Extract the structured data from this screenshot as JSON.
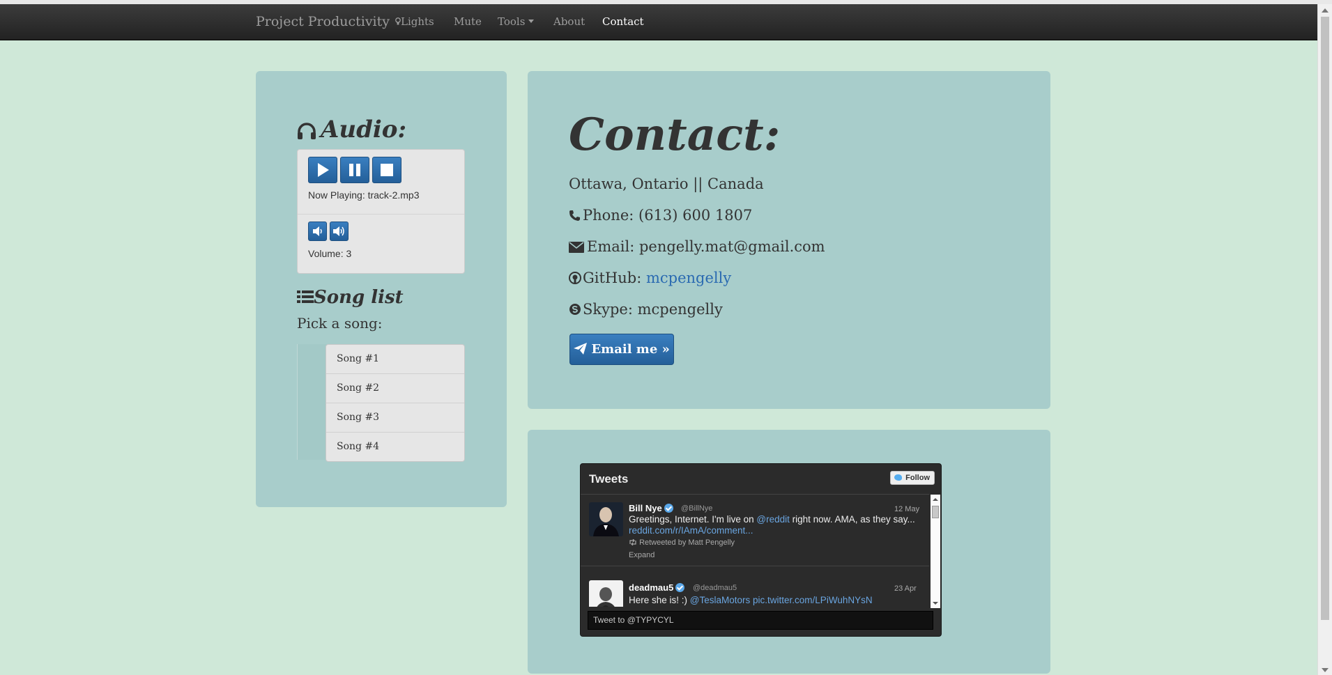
{
  "navbar": {
    "brand": "Project Productivity",
    "items": [
      {
        "label": "Lights",
        "icon": "lightbulb-icon"
      },
      {
        "label": "Mute"
      },
      {
        "label": "Tools",
        "icon": "caret-down-icon"
      },
      {
        "label": "About"
      },
      {
        "label": "Contact",
        "active": true
      }
    ]
  },
  "audio": {
    "title": "Audio:",
    "icon": "headphones-icon",
    "controls": [
      "play-icon",
      "pause-icon",
      "stop-icon"
    ],
    "now_playing": "Now Playing: track-2.mp3",
    "volume_controls": [
      "volume-down-icon",
      "volume-up-icon"
    ],
    "volume": "Volume: 3"
  },
  "songlist": {
    "title": "Song list",
    "icon": "list-icon",
    "prompt": "Pick a song:",
    "songs": [
      "Song #1",
      "Song #2",
      "Song #3",
      "Song #4"
    ]
  },
  "contact": {
    "title": "Contact:",
    "location": "Ottawa, Ontario || Canada",
    "phone_label": "Phone: (613) 600 1807",
    "email_label": "Email: pengelly.mat@gmail.com",
    "github_label": "GitHub: ",
    "github_link": "mcpengelly",
    "skype_label": "Skype: mcpengelly",
    "button": "Email me »"
  },
  "tweets": {
    "title": "Tweets",
    "follow": "Follow",
    "items": [
      {
        "name": "Bill Nye",
        "handle": "@BillNye",
        "date": "12 May",
        "text_a": "Greetings, Internet. I'm live on ",
        "mention": "@reddit",
        "text_b": " right now. AMA, as they say... ",
        "link": "reddit.com/r/IAmA/comment...",
        "retweet": "Retweeted by Matt Pengelly",
        "expand": "Expand"
      },
      {
        "name": "deadmau5",
        "handle": "@deadmau5",
        "date": "23 Apr",
        "text_a": "Here she is! :) ",
        "mention": "@TeslaMotors",
        "link": "pic.twitter.com/LPiWuhNYsN"
      }
    ],
    "input_placeholder": "Tweet to @TYPYCYL"
  },
  "colors": {
    "page_bg": "#cfe8d8",
    "panel_bg": "#a8cdcb",
    "button_blue": "#2d6ca8",
    "link_blue": "#2a6ab1"
  }
}
